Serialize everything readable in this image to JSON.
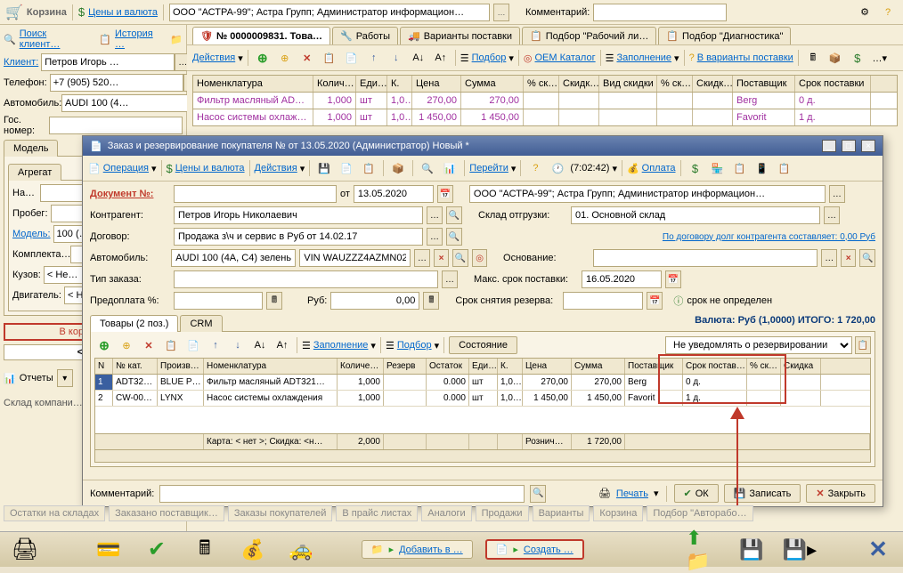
{
  "topbar": {
    "title": "Корзина",
    "prices_link": "Цены и валюта",
    "company": "ООО \"АСТРА-99\"; Астра Групп; Администратор информацион…",
    "comment_label": "Комментарий:"
  },
  "left": {
    "search_client": "Поиск клиент…",
    "history": "История …",
    "client_lbl": "Клиент:",
    "client": "Петров Игорь …",
    "phone_lbl": "Телефон:",
    "phone": "+7 (905) 520…",
    "auto_lbl": "Автомобиль:",
    "auto": "AUDI 100 (4…",
    "gos_lbl": "Гос. номер:",
    "tab_model": "Модель",
    "tab_agregat": "Агрегат",
    "na": "На…",
    "probeg": "Пробег:",
    "model": "Модель:",
    "model_val": "100 (…",
    "kompl": "Комплекта…",
    "kuzov": "Кузов:",
    "kuzov_val": "< Не…",
    "dvig": "Двигатель:",
    "dvig_val": "< Не…",
    "redbox": "В корзине то…",
    "v12": "< 1 2…",
    "reports": "Отчеты",
    "sklad": "Склад компани…"
  },
  "main_tabs": [
    "№ 0000009831. Това…",
    "Работы",
    "Варианты поставки",
    "Подбор \"Рабочий ли…",
    "Подбор \"Диагностика\""
  ],
  "main_bar": {
    "actions": "Действия",
    "podbor": "Подбор",
    "oem": "ОЕМ Каталог",
    "zapol": "Заполнение",
    "varpos": "В варианты поставки"
  },
  "main_cols": [
    "Номенклатура",
    "Колич…",
    "Еди…",
    "К.",
    "Цена",
    "Сумма",
    "% ск…",
    "Скидк…",
    "Вид скидки",
    "% ск…",
    "Скидк…",
    "Поставщик",
    "Срок поставки"
  ],
  "main_rows": [
    {
      "nom": "Фильтр масляный AD…",
      "qty": "1,000",
      "unit": "шт",
      "k": "1,0…",
      "price": "270,00",
      "sum": "270,00",
      "supplier": "Berg",
      "srok": "0 д."
    },
    {
      "nom": "Насос системы охлаж…",
      "qty": "1,000",
      "unit": "шт",
      "k": "1,0…",
      "price": "1 450,00",
      "sum": "1 450,00",
      "supplier": "Favorit",
      "srok": "1 д."
    }
  ],
  "modal": {
    "title": "Заказ и резервирование покупателя № от 13.05.2020 (Администратор) Новый *",
    "op": "Операция",
    "prices": "Цены и валюта",
    "actions": "Действия",
    "goto": "Перейти",
    "time": "(7:02:42)",
    "oplata": "Оплата",
    "doc_lbl": "Документ №:",
    "date_lbl": "от",
    "date": "13.05.2020",
    "company": "ООО \"АСТРА-99\"; Астра Групп; Администратор информацион…",
    "contr_lbl": "Контрагент:",
    "contr": "Петров Игорь Николаевич",
    "sklad_lbl": "Склад отгрузки:",
    "sklad": "01. Основной склад",
    "dog_lbl": "Договор:",
    "dog": "Продажа з\\ч и сервис в Руб от 14.02.17",
    "debt_link": "По договору долг контрагента составляет: 0,00 Руб",
    "auto_lbl": "Автомобиль:",
    "auto": "AUDI 100 (4A, C4) зеленый",
    "vin": "VIN WAUZZZ4AZMN022…",
    "osn_lbl": "Основание:",
    "tip_lbl": "Тип заказа:",
    "srok_lbl": "Макс. срок поставки:",
    "srok": "16.05.2020",
    "prepay_lbl": "Предоплата %:",
    "rub_lbl": "Руб:",
    "rub_val": "0,00",
    "reserve_lbl": "Срок снятия резерва:",
    "reserve_note": "срок не определен",
    "tab_goods": "Товары (2 поз.)",
    "tab_crm": "CRM",
    "total_line": "Валюта: Руб (1,0000) ИТОГО: 1 720,00",
    "fill": "Заполнение",
    "podbor": "Подбор",
    "state": "Состояние",
    "notify": "Не уведомлять о резервировании",
    "dt_cols": [
      "N",
      "№ кат.",
      "Произв…",
      "Номенклатура",
      "Количе…",
      "Резерв",
      "Остаток",
      "Еди…",
      "К.",
      "Цена",
      "Сумма",
      "Поставщик",
      "Срок постав…",
      "% ск…",
      "Скидка"
    ],
    "dt_rows": [
      {
        "n": "1",
        "kat": "ADT32…",
        "pr": "BLUE P…",
        "nom": "Фильтр масляный ADT321…",
        "qty": "1,000",
        "res": "",
        "ost": "0.000",
        "unit": "шт",
        "k": "1,0…",
        "price": "270,00",
        "sum": "270,00",
        "sup": "Berg",
        "srok": "0 д."
      },
      {
        "n": "2",
        "kat": "CW-00…",
        "pr": "LYNX",
        "nom": "Насос системы охлаждения",
        "qty": "1,000",
        "res": "",
        "ost": "0.000",
        "unit": "шт",
        "k": "1,0…",
        "price": "1 450,00",
        "sum": "1 450,00",
        "sup": "Favorit",
        "srok": "1 д."
      }
    ],
    "footer_karta": "Карта: < нет >; Скидка: <н…",
    "footer_qty": "2,000",
    "footer_rozn": "Рознич…",
    "footer_total": "1 720,00",
    "comment_lbl": "Комментарий:",
    "print": "Печать",
    "ok": "ОК",
    "save": "Записать",
    "close": "Закрыть"
  },
  "bottom": {
    "add": "Добавить в …",
    "create": "Создать …"
  },
  "status_tabs": [
    "Остатки на складах",
    "Заказано поставщик…",
    "Заказы покупателей",
    "В прайс листах",
    "Аналоги",
    "Продажи",
    "Варианты",
    "Корзина",
    "Подбор \"Авторабо…"
  ]
}
